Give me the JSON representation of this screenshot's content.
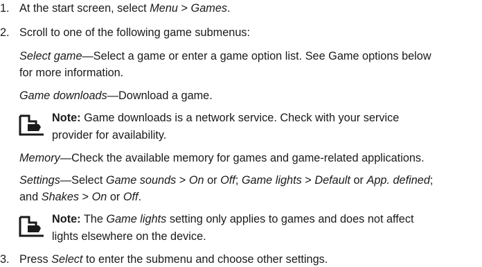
{
  "steps": {
    "s1": {
      "num": "1.",
      "a": "At the start screen, select ",
      "menu": "Menu",
      "sep": " > ",
      "games": "Games",
      "end": "."
    },
    "s2": {
      "num": "2.",
      "text": "Scroll to one of the following game submenus:"
    },
    "s3": {
      "num": "3.",
      "a": "Press ",
      "select": "Select",
      "b": " to enter the submenu and choose other settings."
    }
  },
  "submenus": {
    "select_game": {
      "term": "Select game",
      "dash": "—",
      "desc1": "Select a game or enter a game option list. See Game options below",
      "desc2": "for more information."
    },
    "downloads": {
      "term": "Game downloads",
      "dash": "—",
      "desc": "Download a game."
    },
    "memory": {
      "term": "Memory",
      "dash": "—",
      "desc": "Check the available memory for games and game-related applications."
    },
    "settings": {
      "term": "Settings",
      "dash": "—",
      "t1": "Select ",
      "game_sounds": "Game sounds",
      "sep1": " > ",
      "on1": "On",
      "or1": " or ",
      "off1": "Off",
      "semi1": "; ",
      "game_lights": "Game lights",
      "sep2": " > ",
      "default": "Default",
      "or2": " or ",
      "app_defined": "App. defined",
      "semi2": ";",
      "and": "and ",
      "shakes": "Shakes",
      "sep3": " > ",
      "on2": "On",
      "or3": " or ",
      "off2": "Off",
      "end": "."
    }
  },
  "notes": {
    "n1": {
      "label": "Note:",
      "line1": " Game downloads is a network service. Check with your service",
      "line2": "provider for availability."
    },
    "n2": {
      "label": "Note:",
      "pre": "  The ",
      "term": "Game lights",
      "line1": " setting only applies to games and does not affect",
      "line2": "lights elsewhere on the device."
    }
  }
}
